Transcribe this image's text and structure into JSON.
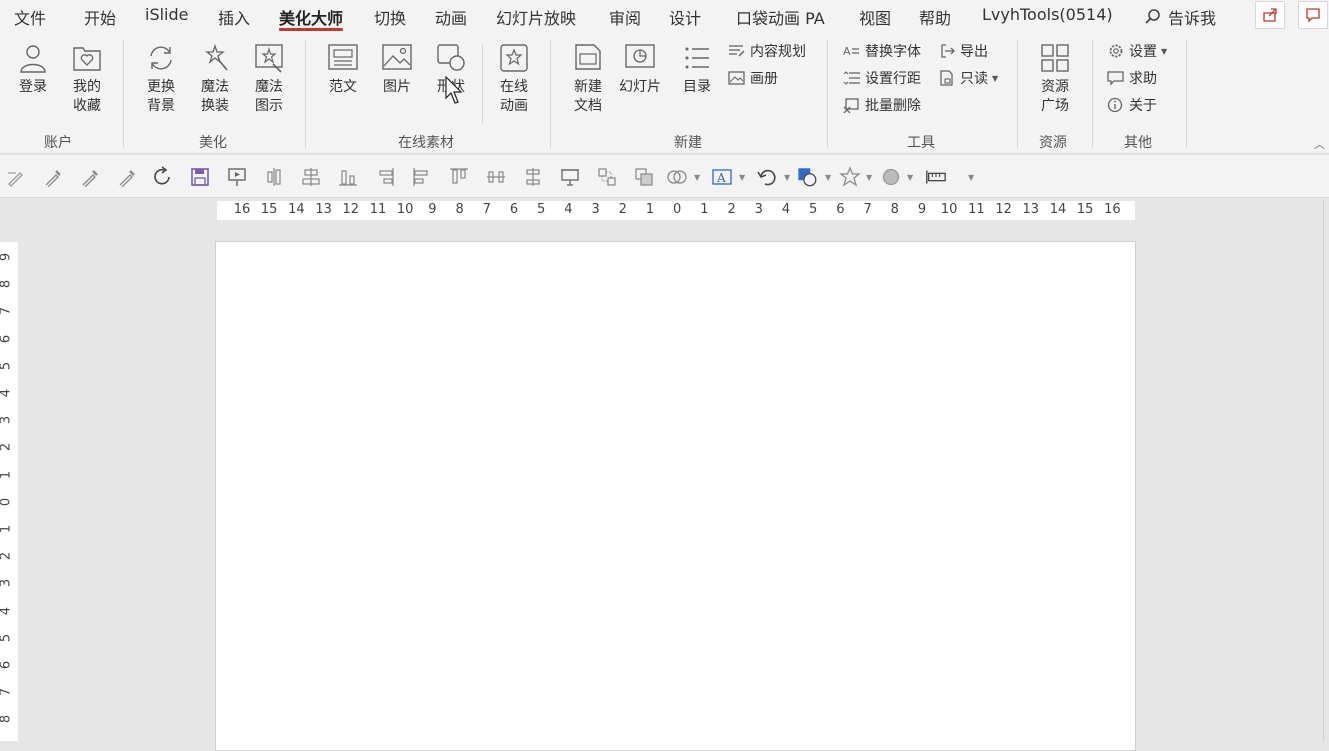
{
  "menu": {
    "tabs": [
      "文件",
      "开始",
      "iSlide",
      "插入",
      "美化大师",
      "切换",
      "动画",
      "幻灯片放映",
      "审阅",
      "设计",
      "口袋动画 PA",
      "视图",
      "帮助",
      "LvyhTools(0514)"
    ],
    "active_tab": "美化大师",
    "tell_me": "告诉我"
  },
  "ribbon": {
    "account": {
      "label": "账户",
      "login": "登录",
      "fav1": "我的",
      "fav2": "收藏"
    },
    "beautify": {
      "label": "美化",
      "bg1": "更换",
      "bg2": "背景",
      "magic1": "魔法",
      "magic2": "换装",
      "diag1": "魔法",
      "diag2": "图示"
    },
    "online": {
      "label": "在线素材",
      "sample": "范文",
      "picture": "图片",
      "shape": "形状",
      "anim1": "在线",
      "anim2": "动画"
    },
    "new": {
      "label": "新建",
      "doc1": "新建",
      "doc2": "文档",
      "slide": "幻灯片",
      "toc": "目录",
      "content_plan": "内容规划",
      "album": "画册"
    },
    "tools": {
      "label": "工具",
      "replace_font": "替换字体",
      "line_spacing": "设置行距",
      "batch_delete": "批量删除",
      "export": "导出",
      "readonly": "只读"
    },
    "resources": {
      "label": "资源",
      "plaza1": "资源",
      "plaza2": "广场"
    },
    "other": {
      "label": "其他",
      "settings": "设置",
      "help": "求助",
      "about": "关于"
    }
  },
  "ruler": {
    "horizontal": [
      "16",
      "15",
      "14",
      "13",
      "12",
      "11",
      "10",
      "9",
      "8",
      "7",
      "6",
      "5",
      "4",
      "3",
      "2",
      "1",
      "0",
      "1",
      "2",
      "3",
      "4",
      "5",
      "6",
      "7",
      "8",
      "9",
      "10",
      "11",
      "12",
      "13",
      "14",
      "15",
      "16"
    ],
    "vertical": [
      "9",
      "8",
      "7",
      "6",
      "5",
      "4",
      "3",
      "2",
      "1",
      "0",
      "1",
      "2",
      "3",
      "4",
      "5",
      "6",
      "7",
      "8"
    ]
  },
  "colors": {
    "accent": "#c0392b",
    "icon": "#666666",
    "save_icon": "#7b5ea7",
    "link_blue": "#2e6bc6"
  }
}
